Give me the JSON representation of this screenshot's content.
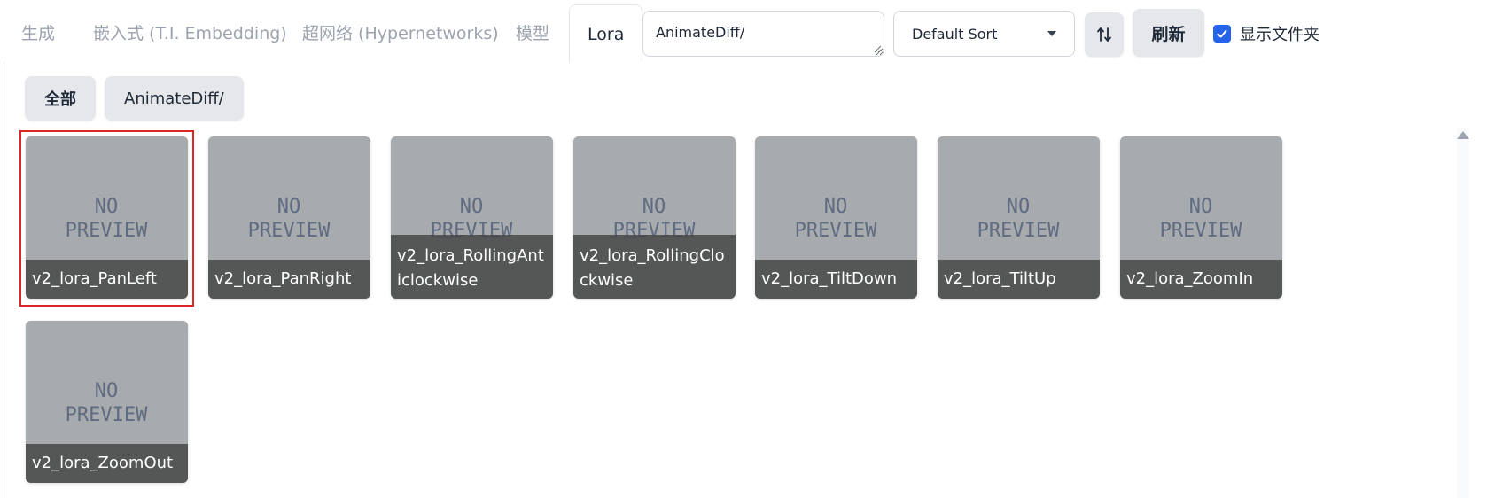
{
  "tabs": [
    {
      "label": "生成"
    },
    {
      "label": "嵌入式 (T.I. Embedding)"
    },
    {
      "label": "超网络 (Hypernetworks)"
    },
    {
      "label": "模型"
    },
    {
      "label": "Lora"
    }
  ],
  "toolbar": {
    "path_value": "AnimateDiff/",
    "sort_value": "Default Sort",
    "order_icon": "sort-order-icon",
    "refresh_label": "刷新",
    "show_dirs_checked": true,
    "show_dirs_label": "显示文件夹"
  },
  "filters": [
    {
      "label": "全部"
    },
    {
      "label": "AnimateDiff/"
    }
  ],
  "preview_placeholder": {
    "line1": "NO",
    "line2": "PREVIEW"
  },
  "cards": [
    {
      "name": "v2_lora_PanLeft",
      "selected": true
    },
    {
      "name": "v2_lora_PanRight",
      "selected": false
    },
    {
      "name": "v2_lora_RollingAnticlockwise",
      "selected": false
    },
    {
      "name": "v2_lora_RollingClockwise",
      "selected": false
    },
    {
      "name": "v2_lora_TiltDown",
      "selected": false
    },
    {
      "name": "v2_lora_TiltUp",
      "selected": false
    },
    {
      "name": "v2_lora_ZoomIn",
      "selected": false
    },
    {
      "name": "v2_lora_ZoomOut",
      "selected": false
    }
  ],
  "colors": {
    "accent": "#2563eb",
    "selection": "#dc2626",
    "card_bg": "#a8abad",
    "card_band": "#464646"
  }
}
